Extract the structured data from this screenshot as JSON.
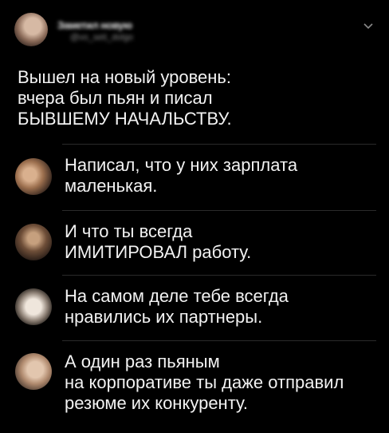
{
  "post": {
    "author_name": "Заметил новую",
    "author_handle": "@vo_seti_dolgo",
    "text_lines": [
      "Вышел на новый уровень:",
      "вчера был пьян и писал",
      "БЫВШЕМУ НАЧАЛЬСТВУ."
    ],
    "menu_icon": "chevron-down-icon"
  },
  "replies": [
    {
      "lines": [
        "Написал, что у них зарплата",
        "маленькая."
      ]
    },
    {
      "lines": [
        "И что ты всегда",
        "ИМИТИРОВАЛ работу."
      ]
    },
    {
      "lines": [
        "На самом деле тебе всегда",
        "нравились их партнеры."
      ]
    },
    {
      "lines": [
        "А один раз пьяным",
        "на корпоративе ты даже отправил",
        "резюме их конкуренту."
      ]
    }
  ],
  "colors": {
    "background": "#000000",
    "text": "#f2f2f2",
    "divider": "#2a2a2a"
  }
}
